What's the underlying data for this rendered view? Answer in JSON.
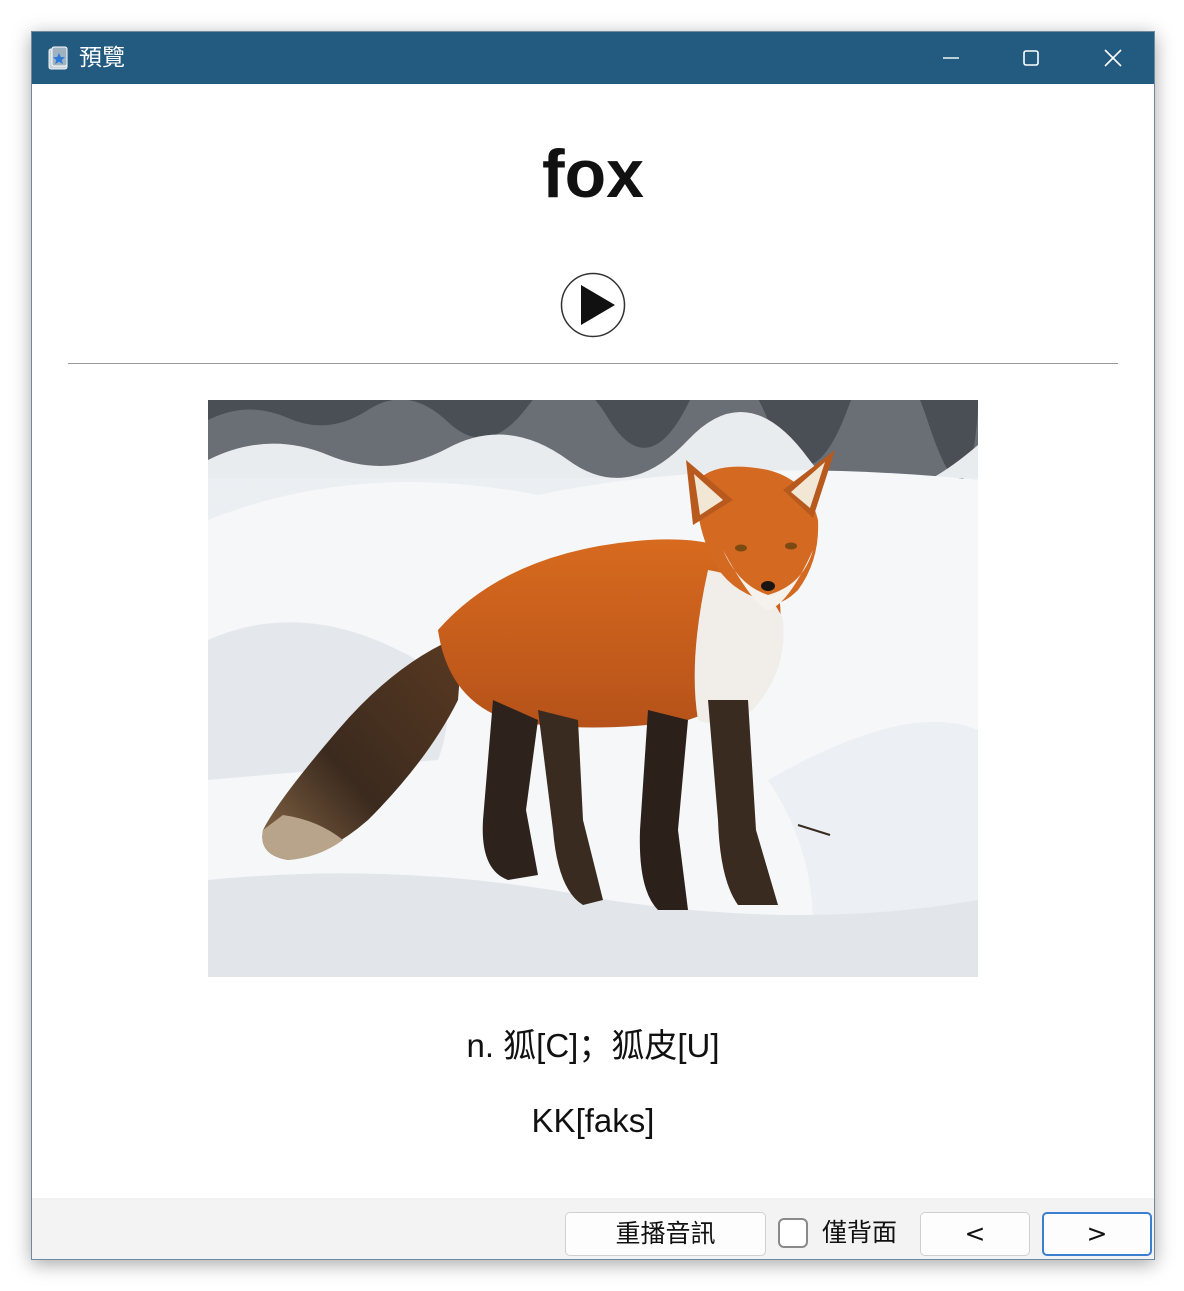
{
  "window": {
    "title": "預覽",
    "icon": "app-star-icon",
    "controls": [
      "minimize-icon",
      "maximize-icon",
      "close-icon"
    ]
  },
  "card": {
    "word": "fox",
    "play_icon": "play-icon",
    "image": "red fox photo",
    "meaning": "n. 狐[C]；狐皮[U]",
    "phonetic": "KK[faks]"
  },
  "footer": {
    "replay_label": "重播音訊",
    "back_only_label": "僅背面",
    "back_only_checked": false,
    "prev_label": "<",
    "next_label": ">"
  },
  "colors": {
    "titlebar": "#235a80",
    "accent_border": "#3b7fd1"
  }
}
